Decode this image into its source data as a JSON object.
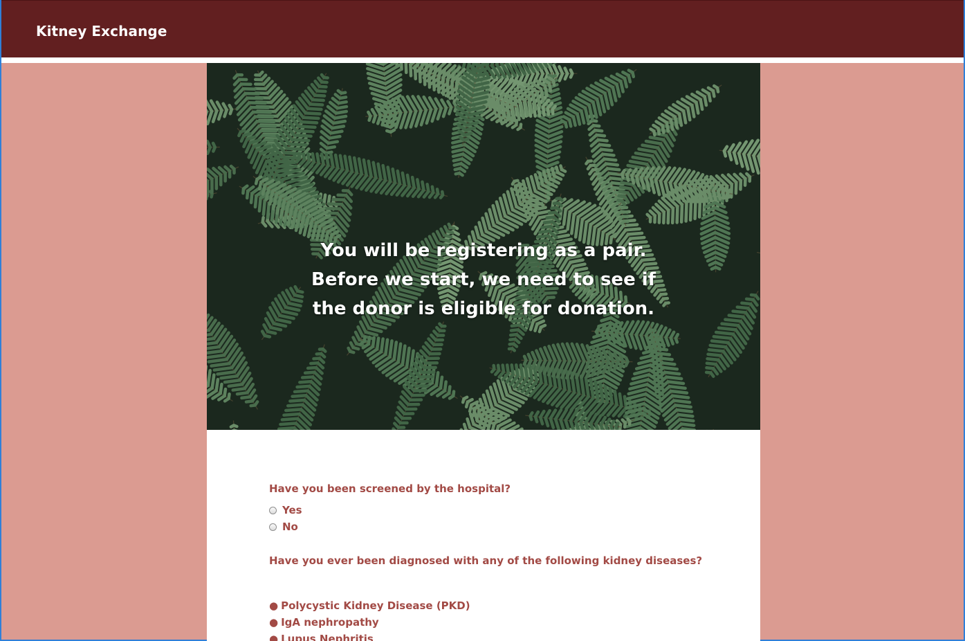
{
  "app": {
    "brand": "Kitney Exchange"
  },
  "colors": {
    "navbar": "#621f20",
    "page_background": "#db9b91",
    "card_background": "#ffffff",
    "question_text": "#a24a45"
  },
  "hero": {
    "lines": [
      "You will be registering as a pair.",
      "Before we start, we need to see if",
      "the donor is eligible for donation."
    ]
  },
  "form": {
    "question_1": "Have you been screened by the hospital?",
    "options": [
      {
        "label": "Yes",
        "selected": false
      },
      {
        "label": "No",
        "selected": false
      }
    ],
    "question_2": "Have you ever been diagnosed with any of the following kidney diseases?",
    "diseases": [
      "Polycystic Kidney Disease (PKD)",
      "IgA nephropathy",
      "Lupus Nephritis"
    ],
    "bullet": "●"
  }
}
